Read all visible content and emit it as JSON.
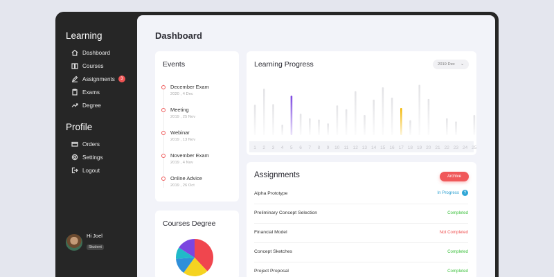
{
  "sidebar": {
    "learning_heading": "Learning",
    "profile_heading": "Profile",
    "learning_items": [
      {
        "label": "Dashboard",
        "icon": "home-icon"
      },
      {
        "label": "Courses",
        "icon": "book-icon"
      },
      {
        "label": "Assignments",
        "icon": "pencil-icon",
        "badge": "3"
      },
      {
        "label": "Exams",
        "icon": "clipboard-icon"
      },
      {
        "label": "Degree",
        "icon": "trend-icon"
      }
    ],
    "profile_items": [
      {
        "label": "Orders",
        "icon": "card-icon"
      },
      {
        "label": "Settings",
        "icon": "gear-icon"
      },
      {
        "label": "Logout",
        "icon": "logout-icon"
      }
    ],
    "user": {
      "greeting": "Hi Joel",
      "role": "Student"
    }
  },
  "main": {
    "title": "Dashboard",
    "events": {
      "title": "Events",
      "items": [
        {
          "name": "December Exam",
          "date": "2020 , 4 Dec"
        },
        {
          "name": "Meeting",
          "date": "2019 , 25 Nov"
        },
        {
          "name": "Webinar",
          "date": "2019 , 13 Nov"
        },
        {
          "name": "November Exam",
          "date": "2019 , 4 Nov"
        },
        {
          "name": "Online Advice",
          "date": "2019 , 26 Oct"
        }
      ]
    },
    "courses_degree": {
      "title": "Courses Degree"
    },
    "learning_progress": {
      "title": "Learning Progress",
      "selector": "2019 Dec"
    },
    "assignments": {
      "title": "Assignments",
      "archive_label": "Archive",
      "rows": [
        {
          "name": "Alpha Prototype",
          "status": "In Progress",
          "info": "?"
        },
        {
          "name": "Preliminary Concept Selection",
          "status": "Completed"
        },
        {
          "name": "Financial Model",
          "status": "Not Completed"
        },
        {
          "name": "Concept Sketches",
          "status": "Completed"
        },
        {
          "name": "Project Proposal",
          "status": "Completed"
        }
      ]
    }
  },
  "colors": {
    "sidebar_bg": "#262626",
    "accent_red": "#ef5353",
    "completed": "#3ec13e",
    "not_completed": "#ef5353",
    "in_progress": "#2a9fd0",
    "bar_gray": "#e3e3e6",
    "bar_purple": "#7b46e0",
    "bar_yellow": "#f2b600"
  },
  "chart_data": [
    {
      "type": "bar",
      "title": "Learning Progress",
      "categories": [
        "1",
        "2",
        "3",
        "4",
        "5",
        "6",
        "7",
        "8",
        "9",
        "10",
        "11",
        "12",
        "13",
        "14",
        "15",
        "16",
        "17",
        "18",
        "19",
        "20",
        "21",
        "22",
        "23",
        "24",
        "25",
        "26",
        "27",
        "28",
        "29"
      ],
      "values": [
        47,
        72,
        48,
        16,
        61,
        33,
        26,
        24,
        18,
        46,
        40,
        68,
        31,
        55,
        74,
        58,
        42,
        23,
        78,
        56,
        26,
        21,
        31,
        14
      ],
      "label_indices": [
        1,
        2,
        3,
        4,
        5,
        6,
        7,
        8,
        9,
        10,
        11,
        12,
        13,
        14,
        15,
        16,
        17,
        18,
        19,
        20,
        22,
        23,
        25,
        26,
        27,
        28,
        29
      ],
      "highlight": {
        "5": "purple",
        "17": "yellow"
      }
    },
    {
      "type": "pie",
      "title": "Courses Degree",
      "slices": [
        {
          "value": 38,
          "color": "#f0464e"
        },
        {
          "value": 22,
          "color": "#f5d321"
        },
        {
          "value": 14,
          "color": "#2f8fd9"
        },
        {
          "value": 10,
          "color": "#20b9c9"
        },
        {
          "value": 16,
          "color": "#7b46e0"
        }
      ]
    }
  ]
}
